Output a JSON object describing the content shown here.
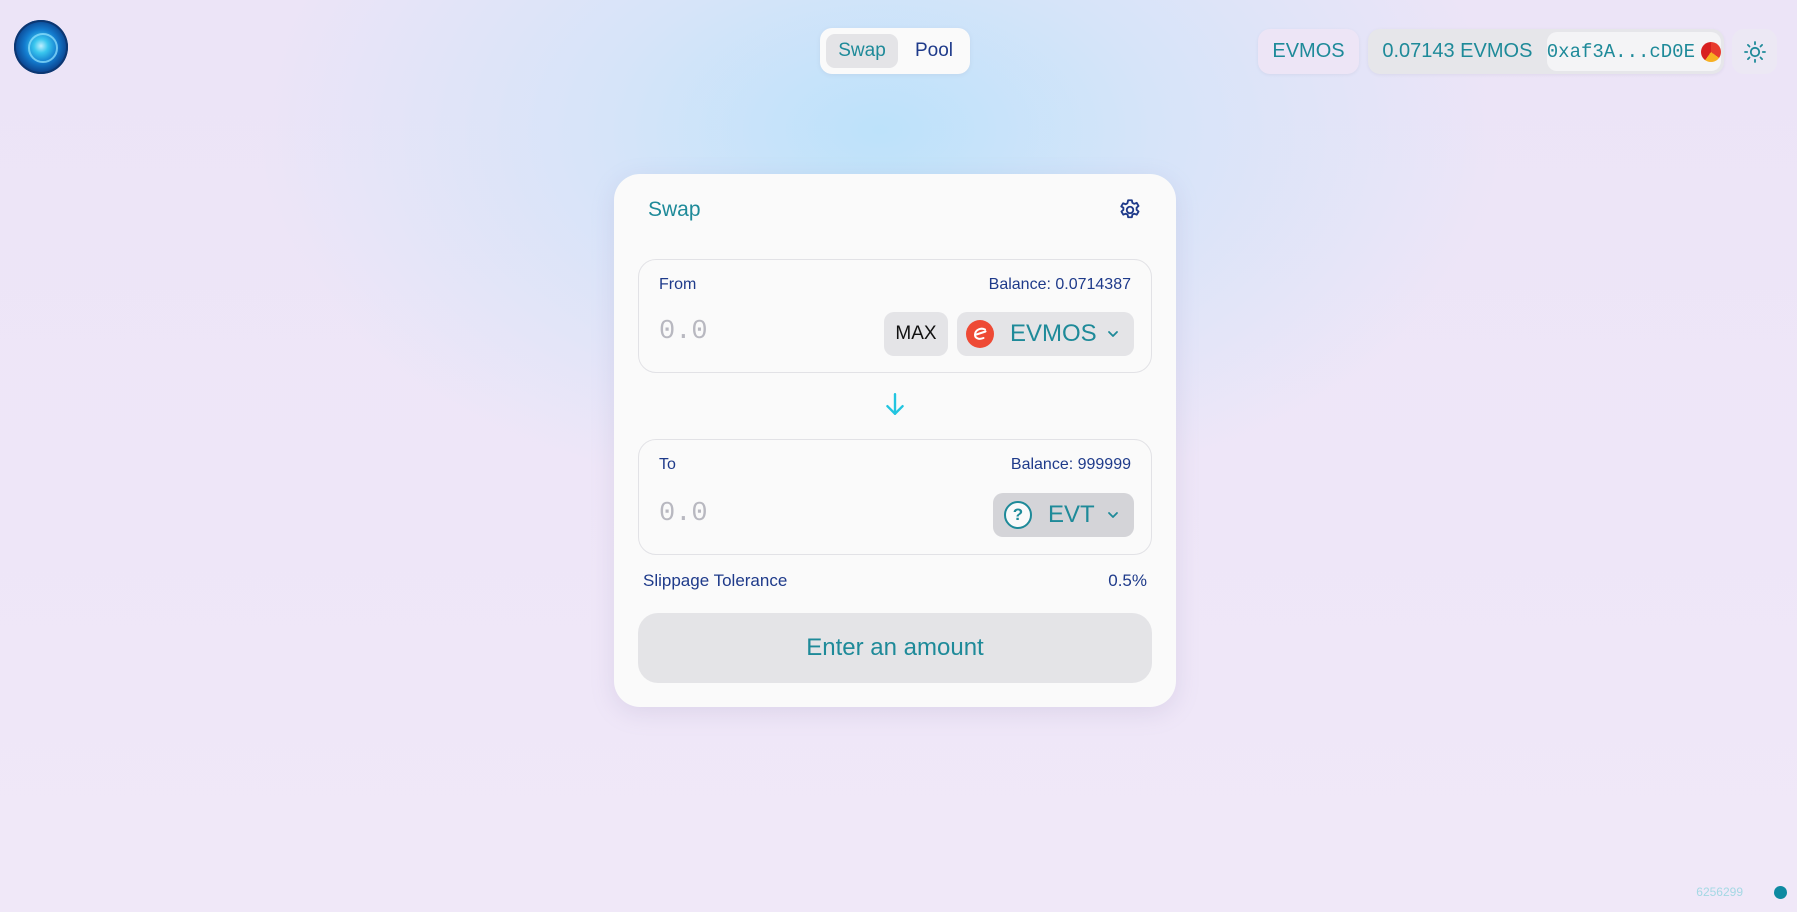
{
  "header": {
    "nav_tabs": [
      {
        "label": "Swap",
        "active": true
      },
      {
        "label": "Pool",
        "active": false
      }
    ],
    "network_label": "EVMOS",
    "wallet_balance": "0.07143 EVMOS",
    "wallet_address": "0xaf3A...cD0E",
    "theme_icon": "sun-icon"
  },
  "swap": {
    "title": "Swap",
    "settings_icon": "gear-icon",
    "from": {
      "label": "From",
      "balance": "Balance: 0.0714387",
      "amount_placeholder": "0.0",
      "max_label": "MAX",
      "token": "EVMOS"
    },
    "to": {
      "label": "To",
      "balance": "Balance: 999999",
      "amount_placeholder": "0.0",
      "token": "EVT",
      "token_icon_glyph": "?"
    },
    "slippage": {
      "label": "Slippage Tolerance",
      "value": "0.5%"
    },
    "submit_label": "Enter an amount"
  },
  "footer": {
    "block_number": "6256299"
  },
  "colors": {
    "accent_teal": "#1e8a99",
    "text_navy": "#1e3a8a",
    "arrow_cyan": "#22c5e0",
    "evmos_red": "#ee4a35"
  }
}
